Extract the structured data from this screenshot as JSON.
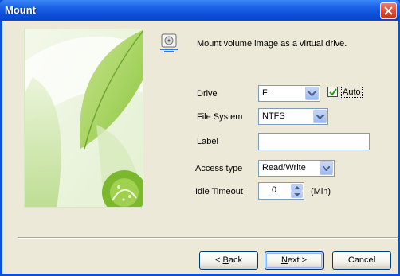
{
  "window": {
    "title": "Mount"
  },
  "heading": "Mount volume image as a virtual drive.",
  "fields": {
    "drive": {
      "label": "Drive",
      "value": "F:"
    },
    "auto": {
      "label": "Auto",
      "checked": true
    },
    "file_system": {
      "label": "File System",
      "value": "NTFS"
    },
    "volume_label": {
      "label": "Label",
      "value": ""
    },
    "access_type": {
      "label": "Access type",
      "value": "Read/Write"
    },
    "idle_timeout": {
      "label": "Idle Timeout",
      "value": "0",
      "unit": "(Min)"
    }
  },
  "buttons": {
    "back": {
      "prefix": "< ",
      "mnemonic": "B",
      "rest": "ack"
    },
    "next": {
      "mnemonic": "N",
      "rest": "ext >"
    },
    "cancel": "Cancel"
  },
  "colors": {
    "titlebar": "#0a4fd6",
    "dialog_bg": "#ece9d8",
    "field_border": "#7f9db9",
    "close_button": "#d5482b"
  },
  "icons": [
    "close-icon",
    "disk-drive-icon",
    "dropdown-arrow-icon",
    "checkmark-icon",
    "spin-up-icon",
    "spin-down-icon"
  ]
}
